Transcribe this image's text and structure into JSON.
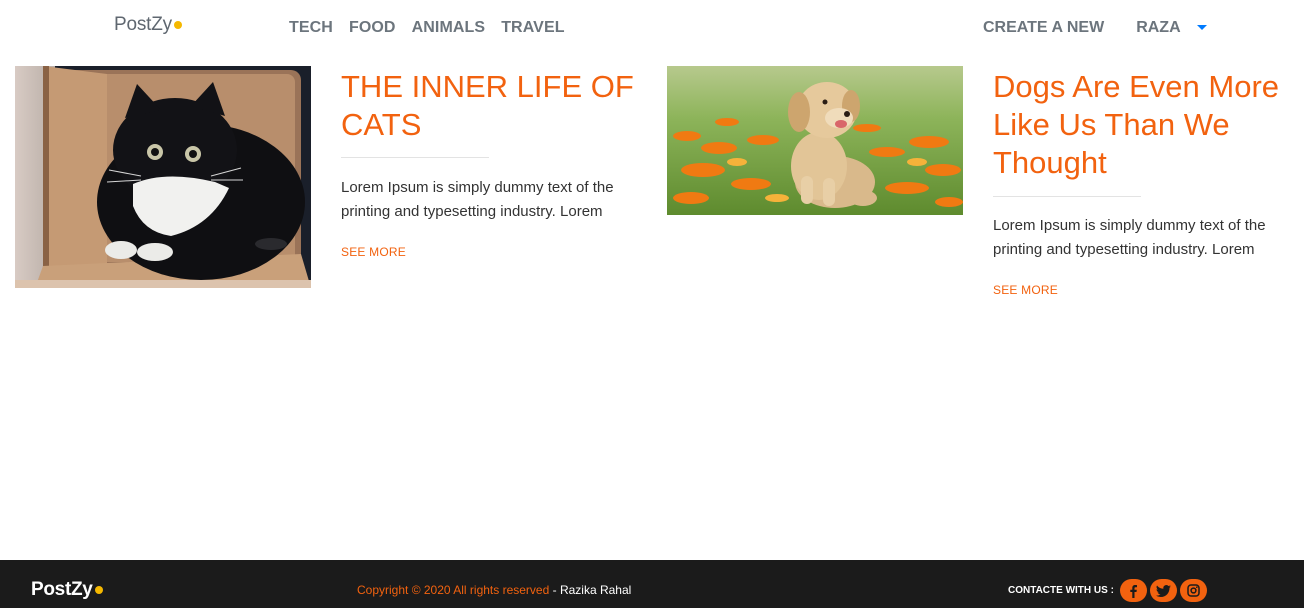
{
  "colors": {
    "accent": "#f2620f",
    "brand_dot": "#f5b800",
    "caret": "#007bff",
    "nav_text": "#6c757d",
    "footer_bg": "#1b1b1b"
  },
  "navbar": {
    "brand": "PostZy",
    "links": [
      "TECH",
      "FOOD",
      "ANIMALS",
      "TRAVEL"
    ],
    "create_label": "CREATE A NEW",
    "user_name": "RAZA",
    "user_menu_icon": "caret-down-icon"
  },
  "posts": [
    {
      "image": "cat-in-cardboard-box",
      "title": "THE INNER LIFE OF CATS",
      "excerpt": "Lorem Ipsum is simply dummy text of the printing and typesetting industry. Lorem",
      "link": "SEE MORE"
    },
    {
      "image": "puppy-in-flower-field",
      "title": "Dogs Are Even More Like Us Than We Thought",
      "excerpt": "Lorem Ipsum is simply dummy text of the printing and typesetting industry. Lorem",
      "link": "SEE MORE"
    }
  ],
  "footer": {
    "brand": "PostZy",
    "copyright": "Copyright © 2020 All rights reserved",
    "separator": " - ",
    "author": "Razika Rahal",
    "contact_label": "CONTACTE WITH US :",
    "social": [
      "facebook-icon",
      "twitter-icon",
      "instagram-icon"
    ]
  }
}
